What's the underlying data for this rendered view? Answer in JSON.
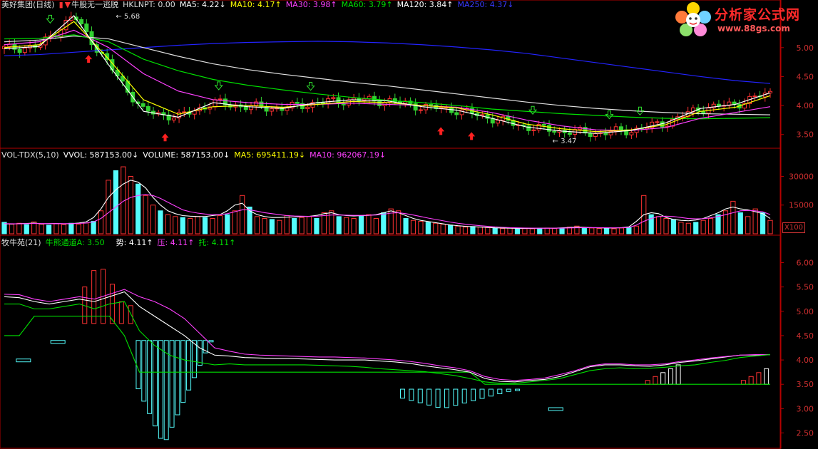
{
  "header1": {
    "stock": "美好集团(日线)",
    "indicator": "牛股无一逃脱",
    "hklnpt": "HKLNPT: 0.00",
    "ma5": "MA5: 4.22↓",
    "ma10": "MA10: 4.17↑",
    "ma30": "MA30: 3.98↑",
    "ma60": "MA60: 3.79↑",
    "ma120": "MA120: 3.84↑",
    "ma250": "MA250: 4.37↓"
  },
  "header2": {
    "name": "VOL-TDX(5,10)",
    "vvol": "VVOL: 587153.00↓",
    "volume": "VOLUME: 587153.00↓",
    "ma5": "MA5: 695411.19↓",
    "ma10": "MA10: 962067.19↓"
  },
  "header3": {
    "name": "牧牛苑(21)",
    "channel": "牛熊通道A: 3.50",
    "shi": "势: 4.11↑",
    "ya": "压: 4.11↑",
    "tuo": "托: 4.11↑"
  },
  "logo": {
    "title": "分析家公式网",
    "url": "www.88gs.com"
  },
  "scale_badge": "X100",
  "colors": {
    "up": "#ff3232",
    "down": "#32d232",
    "ma5": "#ffffff",
    "ma10": "#ffff00",
    "ma30": "#ff40ff",
    "ma60": "#00e000",
    "ma120": "#ffffff",
    "ma250": "#2323ff",
    "vol_cyan": "#54fcfc",
    "axis": "#b30000"
  },
  "chart_data": [
    {
      "type": "line",
      "title": "美好集团(日线)",
      "ylim": [
        3.3,
        5.6
      ],
      "yticks": [
        5.0,
        4.5,
        4.0,
        3.5
      ],
      "annotations": [
        {
          "text": "5.68",
          "kind": "high"
        },
        {
          "text": "3.47",
          "kind": "low"
        }
      ],
      "series": [
        {
          "name": "MA250",
          "values": [
            4.86,
            4.88,
            4.92,
            4.96,
            5.0,
            5.04,
            5.07,
            5.09,
            5.1,
            5.11,
            5.1,
            5.08,
            5.05,
            5.01,
            4.96,
            4.9,
            4.82,
            4.74,
            4.66,
            4.58,
            4.5,
            4.43,
            4.38
          ]
        },
        {
          "name": "MA120",
          "values": [
            5.1,
            5.13,
            5.2,
            5.15,
            5.0,
            4.85,
            4.72,
            4.62,
            4.54,
            4.47,
            4.4,
            4.34,
            4.27,
            4.2,
            4.13,
            4.06,
            4.0,
            3.95,
            3.91,
            3.88,
            3.86,
            3.85,
            3.84
          ]
        },
        {
          "name": "MA60",
          "values": [
            5.15,
            5.16,
            5.22,
            5.1,
            4.8,
            4.6,
            4.45,
            4.35,
            4.27,
            4.2,
            4.14,
            4.09,
            4.05,
            4.0,
            3.94,
            3.9,
            3.86,
            3.83,
            3.8,
            3.78,
            3.77,
            3.78,
            3.79
          ]
        },
        {
          "name": "MA30",
          "values": [
            5.05,
            5.1,
            5.3,
            5.0,
            4.55,
            4.25,
            4.1,
            4.05,
            4.02,
            4.02,
            4.04,
            4.02,
            4.0,
            3.97,
            3.88,
            3.75,
            3.65,
            3.58,
            3.57,
            3.62,
            3.78,
            3.88,
            3.98
          ]
        },
        {
          "name": "MA10",
          "values": [
            5.0,
            5.05,
            5.45,
            4.8,
            4.1,
            3.85,
            3.98,
            4.0,
            3.97,
            4.02,
            4.07,
            4.05,
            4.0,
            3.96,
            3.84,
            3.68,
            3.6,
            3.55,
            3.58,
            3.67,
            3.9,
            3.97,
            4.17
          ]
        },
        {
          "name": "MA5",
          "values": [
            4.98,
            5.02,
            5.55,
            4.7,
            3.9,
            3.8,
            4.05,
            3.98,
            3.95,
            4.05,
            4.1,
            4.08,
            3.98,
            3.92,
            3.78,
            3.63,
            3.56,
            3.52,
            3.57,
            3.7,
            3.95,
            4.02,
            4.22
          ]
        }
      ]
    },
    {
      "type": "bar",
      "title": "VOL-TDX(5,10)",
      "ylim": [
        0,
        38000
      ],
      "yticks": [
        30000,
        15000
      ],
      "unit": "X100",
      "values": [
        6000,
        5000,
        5500,
        4800,
        6200,
        5000,
        4500,
        5200,
        4800,
        5500,
        5000,
        5600,
        6500,
        12000,
        28000,
        33000,
        35000,
        30000,
        26000,
        20000,
        15000,
        12000,
        10000,
        9000,
        8500,
        8000,
        9000,
        8500,
        8000,
        9500,
        10000,
        12000,
        20000,
        14000,
        9000,
        8000,
        7500,
        7000,
        9500,
        8000,
        8500,
        9000,
        8000,
        11000,
        12000,
        9000,
        8500,
        8000,
        9500,
        10000,
        8000,
        11000,
        13000,
        12000,
        8000,
        7000,
        6500,
        6000,
        5500,
        5000,
        4500,
        4000,
        3500,
        3800,
        3500,
        3200,
        3000,
        2800,
        3000,
        2800,
        2700,
        2600,
        2800,
        3000,
        2800,
        2700,
        3500,
        4000,
        3200,
        3000,
        2800,
        3000,
        2600,
        3000,
        3500,
        4000,
        20000,
        10000,
        9000,
        8000,
        7500,
        6000,
        5500,
        6000,
        7000,
        8000,
        10000,
        12000,
        17000,
        11000,
        9000,
        13000,
        11000,
        7000
      ],
      "ma5": [
        5200,
        5100,
        5300,
        5400,
        5600,
        5200,
        5300,
        5400,
        5200,
        5300,
        5600,
        6200,
        8500,
        13000,
        19000,
        23000,
        26000,
        28000,
        27000,
        24000,
        19000,
        15000,
        12000,
        10500,
        9500,
        9200,
        9000,
        9000,
        9500,
        10000,
        12000,
        15000,
        16000,
        12000,
        10000,
        9000,
        8500,
        8500,
        8700,
        8800,
        9000,
        9100,
        9600,
        10500,
        11000,
        10000,
        9500,
        9300,
        9500,
        9600,
        10000,
        11000,
        12000,
        11000,
        9500,
        8000,
        7000,
        6400,
        5800,
        5200,
        4600,
        4200,
        3900,
        3700,
        3500,
        3300,
        3100,
        3000,
        2900,
        2800,
        2800,
        2800,
        2900,
        2900,
        2900,
        3100,
        3300,
        3500,
        3400,
        3200,
        3100,
        3000,
        3000,
        3200,
        3600,
        6500,
        10000,
        11000,
        10500,
        8500,
        7500,
        7000,
        6800,
        7200,
        8000,
        9500,
        11000,
        13000,
        14000,
        13000,
        12500,
        11500,
        10500,
        8000
      ],
      "ma10": [
        5300,
        5250,
        5200,
        5300,
        5400,
        5350,
        5300,
        5350,
        5300,
        5300,
        5400,
        5600,
        6200,
        8000,
        11000,
        14000,
        17000,
        19000,
        20000,
        20500,
        20000,
        18500,
        16500,
        14500,
        12500,
        11500,
        10800,
        10300,
        10000,
        10000,
        10500,
        11500,
        12500,
        12500,
        11800,
        11000,
        10500,
        10000,
        9500,
        9300,
        9200,
        9100,
        9200,
        9500,
        9800,
        9800,
        9700,
        9600,
        9600,
        9700,
        9800,
        10200,
        10800,
        11000,
        10500,
        9800,
        9000,
        8200,
        7500,
        6800,
        6100,
        5500,
        5000,
        4600,
        4200,
        3900,
        3600,
        3400,
        3200,
        3100,
        3000,
        2950,
        2900,
        2900,
        2900,
        2950,
        3050,
        3150,
        3200,
        3250,
        3200,
        3150,
        3100,
        3150,
        3300,
        4500,
        6500,
        8000,
        9000,
        9200,
        9000,
        8500,
        8000,
        7800,
        7900,
        8300,
        9000,
        10000,
        11000,
        12000,
        12200,
        12000,
        11500,
        10000
      ]
    },
    {
      "type": "bar",
      "title": "牧牛苑(21)",
      "ylim": [
        2.2,
        6.3
      ],
      "yticks": [
        6.0,
        5.5,
        5.0,
        4.5,
        4.0,
        3.5,
        3.0,
        2.5
      ],
      "series": [
        {
          "name": "牛熊通道A",
          "values": [
            4.5,
            4.5,
            4.9,
            4.9,
            4.9,
            4.9,
            4.9,
            4.9,
            4.5,
            3.75,
            3.75,
            3.75,
            3.75,
            3.75,
            3.75,
            3.75,
            3.75,
            3.75,
            3.75,
            3.75,
            3.75,
            3.75,
            3.75,
            3.75,
            3.75,
            3.75,
            3.75,
            3.75,
            3.75,
            3.75,
            3.75,
            3.75,
            3.5,
            3.5,
            3.5,
            3.5,
            3.5,
            3.5,
            3.5,
            3.5,
            3.5,
            3.5,
            3.5,
            3.5,
            3.5,
            3.5,
            3.5,
            3.5,
            3.5,
            3.5,
            3.5,
            3.5
          ]
        },
        {
          "name": "势",
          "values": [
            5.3,
            5.28,
            5.2,
            5.15,
            5.2,
            5.25,
            5.2,
            5.3,
            5.4,
            5.1,
            4.9,
            4.7,
            4.5,
            4.25,
            4.1,
            4.08,
            4.05,
            4.04,
            4.03,
            4.03,
            4.02,
            4.01,
            4.0,
            4.0,
            4.0,
            3.98,
            3.96,
            3.93,
            3.88,
            3.84,
            3.8,
            3.75,
            3.62,
            3.56,
            3.55,
            3.58,
            3.6,
            3.66,
            3.76,
            3.86,
            3.9,
            3.9,
            3.88,
            3.87,
            3.9,
            3.95,
            3.98,
            4.02,
            4.06,
            4.1,
            4.1,
            4.11
          ]
        },
        {
          "name": "压",
          "values": [
            5.35,
            5.34,
            5.25,
            5.2,
            5.25,
            5.3,
            5.25,
            5.35,
            5.45,
            5.3,
            5.2,
            5.05,
            4.85,
            4.55,
            4.25,
            4.18,
            4.12,
            4.1,
            4.09,
            4.08,
            4.07,
            4.06,
            4.06,
            4.05,
            4.04,
            4.02,
            4.0,
            3.97,
            3.93,
            3.88,
            3.84,
            3.78,
            3.66,
            3.6,
            3.58,
            3.6,
            3.63,
            3.7,
            3.78,
            3.88,
            3.92,
            3.92,
            3.9,
            3.9,
            3.92,
            3.97,
            4.0,
            4.04,
            4.07,
            4.1,
            4.11,
            4.11
          ]
        },
        {
          "name": "托",
          "values": [
            5.15,
            5.15,
            5.05,
            5.05,
            5.1,
            5.15,
            5.05,
            5.15,
            5.2,
            4.6,
            4.3,
            4.1,
            4.0,
            3.95,
            3.9,
            3.92,
            3.9,
            3.9,
            3.9,
            3.9,
            3.9,
            3.89,
            3.88,
            3.87,
            3.85,
            3.82,
            3.8,
            3.78,
            3.76,
            3.72,
            3.68,
            3.62,
            3.55,
            3.52,
            3.52,
            3.55,
            3.58,
            3.62,
            3.7,
            3.78,
            3.82,
            3.84,
            3.82,
            3.83,
            3.85,
            3.88,
            3.9,
            3.95,
            3.99,
            4.05,
            4.08,
            4.11
          ]
        }
      ]
    }
  ]
}
